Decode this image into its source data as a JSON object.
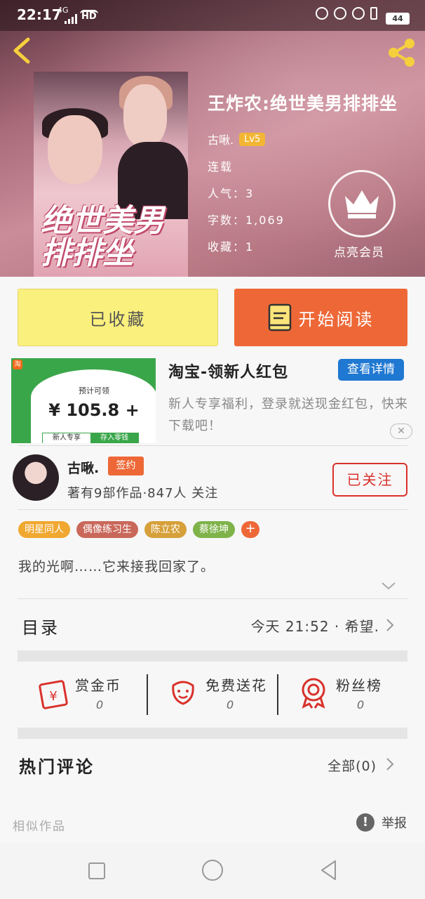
{
  "status_bar": {
    "time": "22:17",
    "network": "4G",
    "hd": "HD",
    "battery": "44"
  },
  "book": {
    "title": "王炸农:绝世美男排排坐",
    "cover_title": "绝世美男排排坐",
    "author": "古啾.",
    "author_level": "Lv5",
    "status": "连载",
    "popularity": "人气：3",
    "word_count": "字数：1,069",
    "favorites": "收藏：1",
    "vip_label": "点亮会员"
  },
  "actions": {
    "collect_label": "已收藏",
    "read_label": "开始阅读"
  },
  "ad": {
    "title": "淘宝-领新人红包",
    "button_label": "查看详情",
    "description": "新人专享福利，登录就送现金红包，快来下载吧！",
    "close_label": "✕",
    "logo_text": "淘",
    "card_label": "预计可领",
    "card_amount": "¥ 105.8 +",
    "card_tab_1": "新人专享",
    "card_tab_2": "存入零钱"
  },
  "author": {
    "name": "古啾.",
    "badge": "签约",
    "stats": "著有9部作品·847人 关注",
    "follow_label": "已关注"
  },
  "tags": [
    {
      "label": "明星同人",
      "color": "#f0a830"
    },
    {
      "label": "偶像练习生",
      "color": "#c9685a"
    },
    {
      "label": "陈立农",
      "color": "#d6a03a"
    },
    {
      "label": "蔡徐坤",
      "color": "#7fb34a"
    }
  ],
  "tag_add": "+",
  "summary": "我的光啊……它来接我回家了。",
  "toc": {
    "label": "目录",
    "latest": "今天 21:52 · 希望."
  },
  "gifts": [
    {
      "label": "赏金币",
      "count": "0",
      "icon": "red-envelope-icon"
    },
    {
      "label": "免费送花",
      "count": "0",
      "icon": "flower-icon"
    },
    {
      "label": "粉丝榜",
      "count": "0",
      "icon": "medal-icon"
    }
  ],
  "comments": {
    "label": "热门评论",
    "all_label": "全部(0)"
  },
  "similar_label": "相似作品",
  "report_label": "举报",
  "report_icon": "!",
  "colors": {
    "accent": "#ee6837",
    "collect": "#faf07d",
    "follow": "#d9312b",
    "ad_button": "#1f78d1"
  }
}
